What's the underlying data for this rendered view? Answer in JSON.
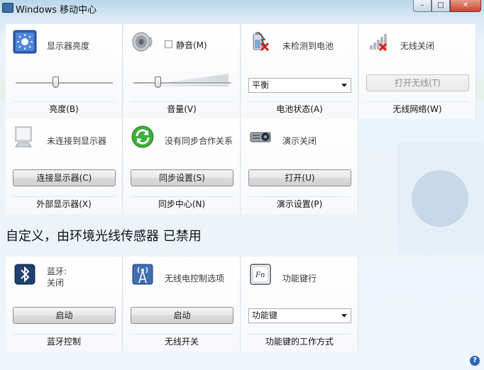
{
  "window": {
    "title": "Windows 移动中心",
    "minimize": "–",
    "maximize": "□",
    "close": "✕"
  },
  "tiles_row1": {
    "brightness": {
      "label": "显示器亮度",
      "title": "亮度(B)",
      "level": 0.41
    },
    "volume": {
      "mute_label": "静音(M)",
      "title": "音量(V)",
      "level": 0.25,
      "muted": false
    },
    "battery": {
      "label": "未检测到电池",
      "plan": "平衡",
      "title": "电池状态(A)"
    },
    "wireless": {
      "label": "无线关闭",
      "button": "打开无线(T)",
      "title": "无线网络(W)"
    }
  },
  "tiles_row2": {
    "display": {
      "label": "未连接到显示器",
      "button": "连接显示器(C)",
      "title": "外部显示器(X)"
    },
    "sync": {
      "label": "没有同步合作关系",
      "button": "同步设置(S)",
      "title": "同步中心(N)"
    },
    "presentation": {
      "label": "演示关闭",
      "button": "打开(U)",
      "title": "演示设置(P)"
    }
  },
  "custom_section": {
    "heading": "自定义，由环境光线传感器 已禁用"
  },
  "tiles_row3": {
    "bluetooth": {
      "label_line1": "蓝牙:",
      "label_line2": "关闭",
      "button": "启动",
      "title": "蓝牙控制"
    },
    "radio": {
      "label": "无线电控制选项",
      "button": "启动",
      "title": "无线开关"
    },
    "fnkey": {
      "label": "功能键行",
      "select": "功能键",
      "title": "功能键的工作方式",
      "icon_text": "Fn"
    }
  },
  "help": "?"
}
